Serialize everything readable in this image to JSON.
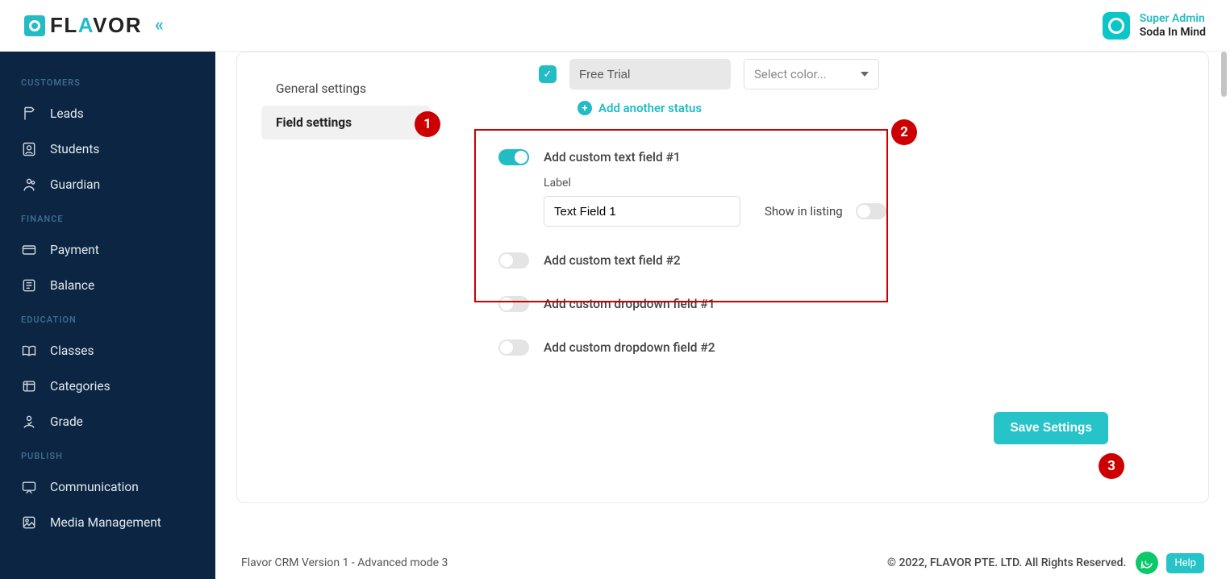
{
  "brand": {
    "name": "FLAVOR",
    "accent_letter_index": 2
  },
  "user": {
    "role": "Super Admin",
    "org": "Soda In Mind"
  },
  "sidebar": {
    "sections": [
      {
        "label": "CUSTOMERS",
        "items": [
          "Leads",
          "Students",
          "Guardian"
        ]
      },
      {
        "label": "FINANCE",
        "items": [
          "Payment",
          "Balance"
        ]
      },
      {
        "label": "EDUCATION",
        "items": [
          "Classes",
          "Categories",
          "Grade"
        ]
      },
      {
        "label": "PUBLISH",
        "items": [
          "Communication",
          "Media Management"
        ]
      }
    ]
  },
  "settings_nav": {
    "items": [
      "General settings",
      "Field settings"
    ],
    "active": 1
  },
  "status": {
    "value": "Free Trial",
    "color_placeholder": "Select color...",
    "add_label": "Add another status"
  },
  "fields": {
    "custom_text_1": {
      "label": "Add custom text field #1",
      "enabled": true,
      "label_heading": "Label",
      "label_value": "Text Field 1",
      "show_listing_label": "Show in listing",
      "show_listing_on": false
    },
    "custom_text_2": {
      "label": "Add custom text field #2",
      "enabled": false
    },
    "custom_dd_1": {
      "label": "Add custom dropdown field #1",
      "enabled": false
    },
    "custom_dd_2": {
      "label": "Add custom dropdown field #2",
      "enabled": false
    }
  },
  "save_label": "Save Settings",
  "footer": {
    "left": "Flavor CRM Version 1 - Advanced mode 3",
    "right": "© 2022, FLAVOR PTE. LTD. All Rights Reserved.",
    "help": "Help"
  },
  "annotations": [
    "1",
    "2",
    "3"
  ]
}
